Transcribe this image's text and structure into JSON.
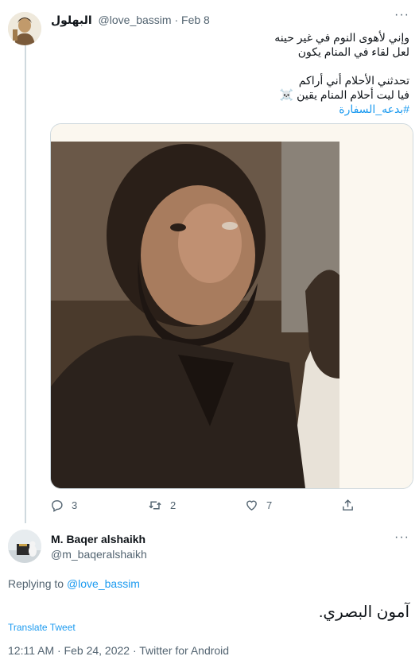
{
  "tweet1": {
    "display_name": "البهلول",
    "handle": "@love_bassim",
    "date": "Feb 8",
    "lines": [
      "وإني لأهوى النوم في غير حينه",
      "لعل لقاء في المنام يكون",
      "تحدثني الأحلام أني أراكم",
      "فيا ليت أحلام المنام يقين ☠️"
    ],
    "hashtag": "#بدعه_السفارة",
    "stats": {
      "replies": "3",
      "retweets": "2",
      "likes": "7"
    }
  },
  "tweet2": {
    "display_name": "M. Baqer alshaikh",
    "handle": "@m_baqeralshaikh",
    "replying_prefix": "Replying to",
    "replying_to": "@love_bassim",
    "text": "آمون البصري.",
    "translate_label": "Translate Tweet",
    "timestamp": "12:11 AM · Feb 24, 2022 · Twitter for Android"
  },
  "more_label": "···",
  "icons": {
    "reply": "reply-icon",
    "retweet": "retweet-icon",
    "like": "heart-icon",
    "share": "share-icon"
  },
  "colors": {
    "link": "#1d9bf0",
    "muted": "#536471",
    "text": "#0f1419",
    "border": "#cfd9de"
  }
}
